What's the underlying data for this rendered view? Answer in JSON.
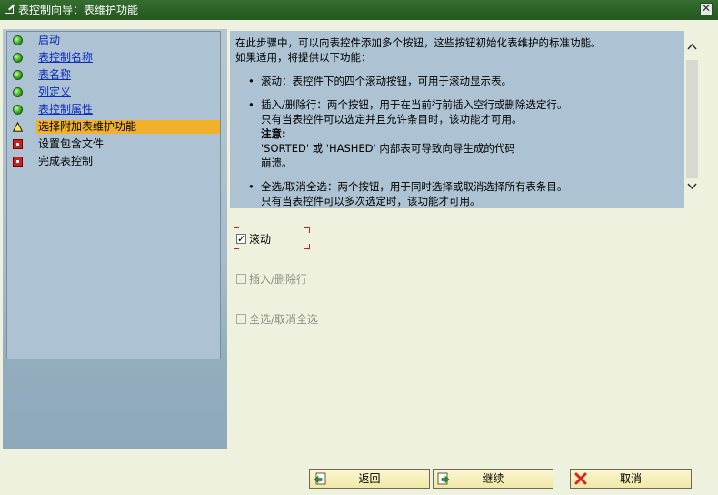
{
  "window": {
    "title": "表控制向导：表维护功能",
    "close_glyph": "✕"
  },
  "steps": [
    {
      "label": "启动",
      "status": "done",
      "icon": "green-dot-icon",
      "link": true
    },
    {
      "label": "表控制名称",
      "status": "done",
      "icon": "green-dot-icon",
      "link": true
    },
    {
      "label": "表名称",
      "status": "done",
      "icon": "green-dot-icon",
      "link": true
    },
    {
      "label": "列定义",
      "status": "done",
      "icon": "green-dot-icon",
      "link": true
    },
    {
      "label": "表控制属性",
      "status": "done",
      "icon": "green-dot-icon",
      "link": true
    },
    {
      "label": "选择附加表维护功能",
      "status": "current",
      "icon": "warning-triangle-icon",
      "link": false
    },
    {
      "label": "设置包含文件",
      "status": "pending",
      "icon": "red-square-icon",
      "link": false
    },
    {
      "label": "完成表控制",
      "status": "pending",
      "icon": "red-square-icon",
      "link": false
    }
  ],
  "info": {
    "intro_line1": "在此步骤中，可以向表控件添加多个按钮，这些按钮初始化表维护的标准功能。",
    "intro_line2": "如果适用，将提供以下功能：",
    "bullet1": "滚动：表控件下的四个滚动按钮，可用于滚动显示表。",
    "bullet2_line1": "插入/删除行：两个按钮，用于在当前行前插入空行或删除选定行。",
    "bullet2_line2": "只有当表控件可以选定并且允许条目时，该功能才可用。",
    "note_label": "注意:",
    "note_line1": "'SORTED' 或 'HASHED' 内部表可导致向导生成的代码",
    "note_line2": "崩溃。",
    "bullet3_line1": "全选/取消全选：两个按钮，用于同时选择或取消选择所有表条目。",
    "bullet3_line2": "只有当表控件可以多次选定时，该功能才可用。"
  },
  "options": {
    "scroll": {
      "label": "滚动",
      "checked": true,
      "check_glyph": "✓"
    },
    "insert_delete": {
      "label": "插入/删除行",
      "checked": false
    },
    "select_all": {
      "label": "全选/取消全选",
      "checked": false
    }
  },
  "buttons": {
    "back": "返回",
    "continue": "继续",
    "cancel": "取消"
  },
  "colors": {
    "titlebar": "#24561f",
    "current_step_highlight": "#f2b12a",
    "link": "#0b2bbd",
    "panel": "#adc3d3"
  }
}
